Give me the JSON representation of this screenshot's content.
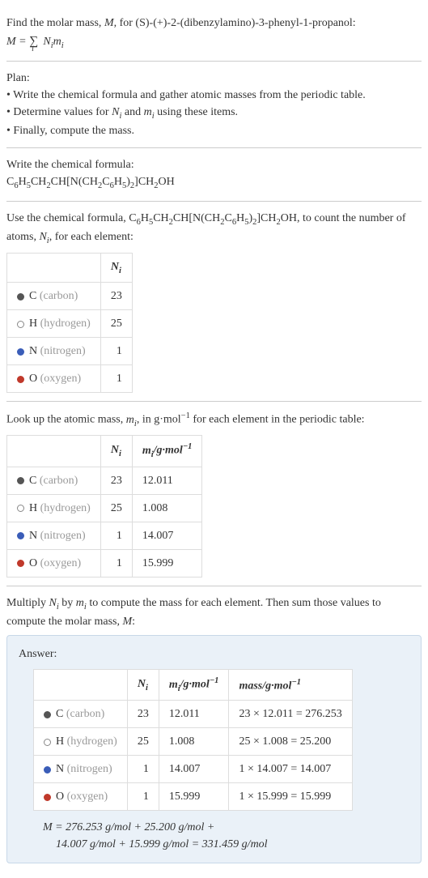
{
  "intro": {
    "line1_prefix": "Find the molar mass, ",
    "M": "M",
    "line1_mid": ", for (S)-(+)-2-(dibenzylamino)-3-phenyl-1-propanol:",
    "formula": "M = ∑ Nᵢmᵢ",
    "formula_sub": "i"
  },
  "plan": {
    "title": "Plan:",
    "items": [
      "Write the chemical formula and gather atomic masses from the periodic table.",
      "Determine values for Nᵢ and mᵢ using these items.",
      "Finally, compute the mass."
    ]
  },
  "write_formula": {
    "title": "Write the chemical formula:",
    "formula_html": "C₆H₅CH₂CH[N(CH₂C₆H₅)₂]CH₂OH"
  },
  "count_section": {
    "text_prefix": "Use the chemical formula, ",
    "formula_html": "C₆H₅CH₂CH[N(CH₂C₆H₅)₂]CH₂OH",
    "text_mid": ", to count the number of atoms, ",
    "Ni": "Nᵢ",
    "text_suffix": ", for each element:",
    "header_Ni": "Nᵢ"
  },
  "elements": [
    {
      "sym": "C",
      "name": "(carbon)",
      "bullet": "b-carbon",
      "N": "23",
      "m": "12.011",
      "mass": "23 × 12.011 = 276.253"
    },
    {
      "sym": "H",
      "name": "(hydrogen)",
      "bullet": "b-hydrogen",
      "N": "25",
      "m": "1.008",
      "mass": "25 × 1.008 = 25.200"
    },
    {
      "sym": "N",
      "name": "(nitrogen)",
      "bullet": "b-nitrogen",
      "N": "1",
      "m": "14.007",
      "mass": "1 × 14.007 = 14.007"
    },
    {
      "sym": "O",
      "name": "(oxygen)",
      "bullet": "b-oxygen",
      "N": "1",
      "m": "15.999",
      "mass": "1 × 15.999 = 15.999"
    }
  ],
  "mass_section": {
    "text_prefix": "Look up the atomic mass, ",
    "mi": "mᵢ",
    "text_mid": ", in g·mol",
    "exp": "−1",
    "text_suffix": " for each element in the periodic table:",
    "header_Ni": "Nᵢ",
    "header_mi": "mᵢ/g·mol⁻¹"
  },
  "multiply_section": {
    "text_prefix": "Multiply ",
    "Ni": "Nᵢ",
    "by": " by ",
    "mi": "mᵢ",
    "text_suffix": " to compute the mass for each element. Then sum those values to compute the molar mass, ",
    "M": "M",
    "colon": ":"
  },
  "answer": {
    "title": "Answer:",
    "header_Ni": "Nᵢ",
    "header_mi": "mᵢ/g·mol⁻¹",
    "header_mass": "mass/g·mol⁻¹",
    "final_line1": "M = 276.253 g/mol + 25.200 g/mol +",
    "final_line2": "14.007 g/mol + 15.999 g/mol = 331.459 g/mol"
  }
}
